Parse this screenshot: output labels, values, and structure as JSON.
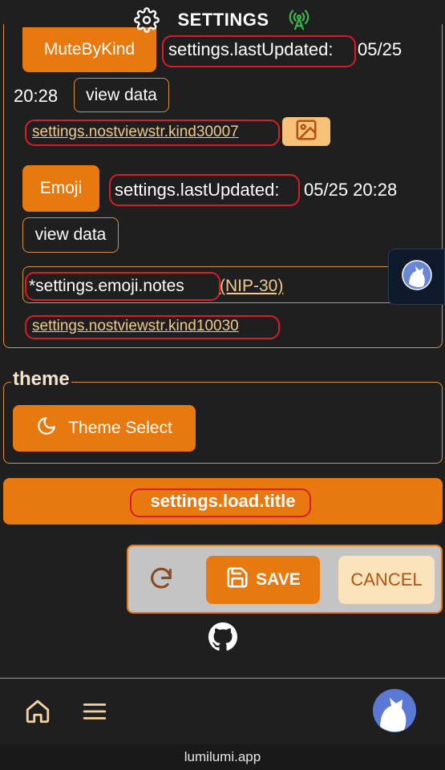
{
  "header": {
    "title": "SETTINGS",
    "icon": "gear-icon",
    "status_icon": "antenna-icon",
    "status_color": "#3bb54a"
  },
  "mute_section": {
    "button_label": "MuteByKind",
    "updated_key": "settings.lastUpdated:",
    "updated_date": "05/25",
    "updated_time": "20:28",
    "view_data_label": "view data",
    "link": "settings.nostviewstr.kind30007"
  },
  "emoji_section": {
    "button_label": "Emoji",
    "updated_key": "settings.lastUpdated:",
    "updated_value": "05/25 20:28",
    "view_data_label": "view data",
    "notes_text": "*settings.emoji.notes",
    "nip_link": "(NIP-30)",
    "link": "settings.nostviewstr.kind10030"
  },
  "theme": {
    "legend": "theme",
    "button_label": "Theme Select"
  },
  "load": {
    "label": "settings.load.title"
  },
  "actions": {
    "save_label": "SAVE",
    "cancel_label": "CANCEL"
  },
  "footer": {
    "url": "lumilumi.app"
  },
  "colors": {
    "accent": "#e8790f",
    "border": "#d98f3c",
    "highlight": "#d91c28",
    "background": "#1f1f1f"
  }
}
